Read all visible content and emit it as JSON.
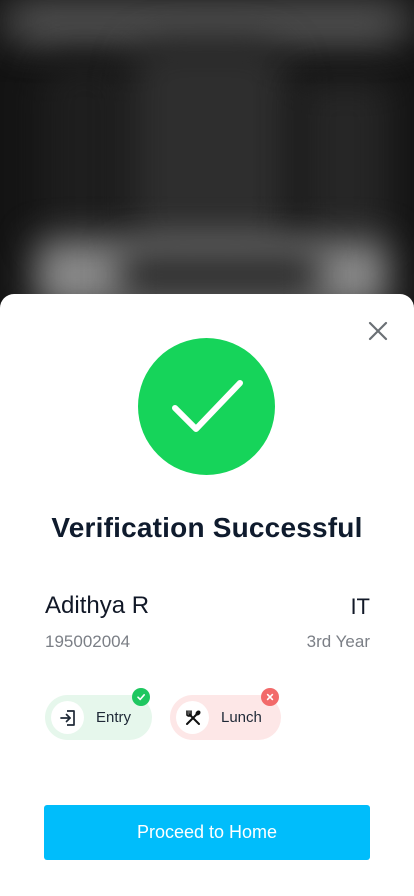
{
  "modal": {
    "title": "Verification Successful",
    "status_color": "#16d45a",
    "status_icon": "checkmark-icon"
  },
  "student": {
    "name": "Adithya R",
    "department": "IT",
    "roll_number": "195002004",
    "year": "3rd Year"
  },
  "access_chips": [
    {
      "label": "Entry",
      "icon": "entry-icon",
      "status": "allowed",
      "color": "#1ec760"
    },
    {
      "label": "Lunch",
      "icon": "utensils-icon",
      "status": "denied",
      "color": "#f26a6a"
    }
  ],
  "actions": {
    "proceed_label": "Proceed to Home",
    "accent": "#00bdfb"
  }
}
